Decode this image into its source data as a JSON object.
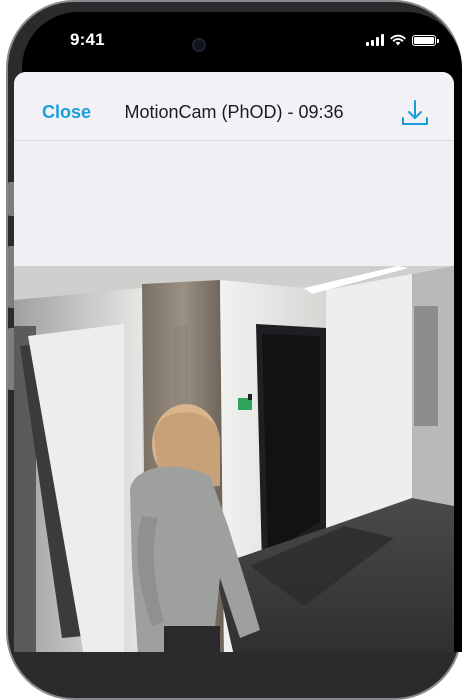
{
  "status_bar": {
    "time": "9:41"
  },
  "nav": {
    "close_label": "Close",
    "title": "MotionCam (PhOD) - 09:36"
  },
  "icons": {
    "download": "download-icon",
    "signal": "signal-icon",
    "wifi": "wifi-icon",
    "battery": "battery-icon"
  },
  "colors": {
    "accent": "#1a9edb",
    "sheet_bg": "#efeff4",
    "frame": "#2b2b2d"
  }
}
